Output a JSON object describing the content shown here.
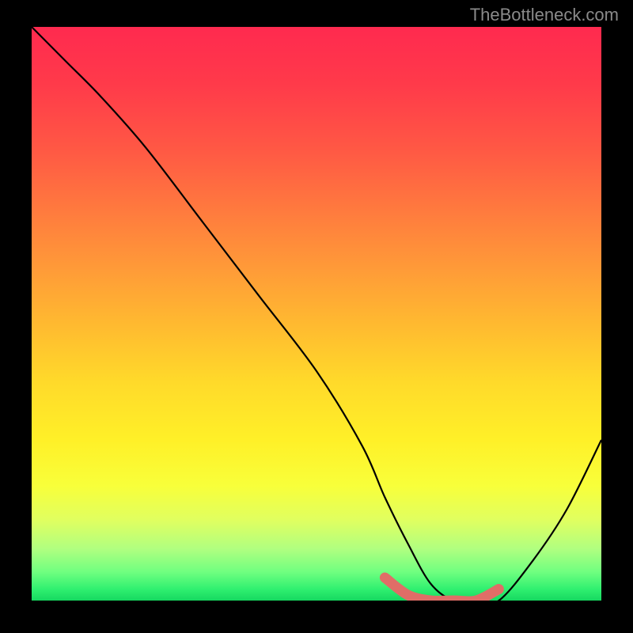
{
  "attribution": "TheBottleneck.com",
  "chart_data": {
    "type": "line",
    "title": "",
    "xlabel": "",
    "ylabel": "",
    "ylim": [
      0,
      100
    ],
    "xlim": [
      0,
      100
    ],
    "series": [
      {
        "name": "bottleneck-curve",
        "x": [
          0,
          6,
          12,
          20,
          30,
          40,
          50,
          58,
          62,
          66,
          70,
          74,
          78,
          82,
          88,
          94,
          100
        ],
        "values": [
          100,
          94,
          88,
          79,
          66,
          53,
          40,
          27,
          18,
          10,
          3,
          0,
          0,
          0,
          7,
          16,
          28
        ]
      }
    ],
    "highlight_segment": {
      "name": "minimum-band",
      "x": [
        62,
        66,
        70,
        74,
        78,
        82
      ],
      "values": [
        4,
        1,
        0,
        0,
        0,
        2
      ],
      "color": "#e06d67"
    },
    "gradient_stops": [
      {
        "pos": 0,
        "color": "#ff2a4f"
      },
      {
        "pos": 50,
        "color": "#ffca30"
      },
      {
        "pos": 80,
        "color": "#f8ff40"
      },
      {
        "pos": 100,
        "color": "#16d860"
      }
    ]
  }
}
